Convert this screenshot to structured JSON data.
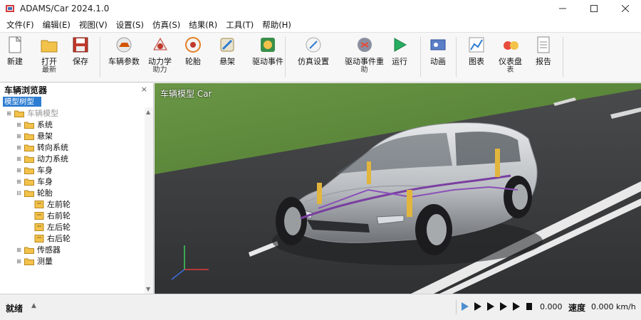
{
  "window": {
    "title": "ADAMS/Car 2024.1.0"
  },
  "menu": [
    "文件(F)",
    "编辑(E)",
    "视图(V)",
    "设置(S)",
    "仿真(S)",
    "结果(R)",
    "工具(T)",
    "帮助(H)"
  ],
  "toolbar": [
    {
      "label": "新建",
      "sub": "",
      "icon": "new-file-icon"
    },
    {
      "label": "打开",
      "sub": "最新",
      "icon": "open-folder-icon"
    },
    {
      "label": "保存",
      "sub": "",
      "icon": "save-icon"
    },
    {
      "label": "车辆参数",
      "sub": "",
      "icon": "vehicle-params-icon"
    },
    {
      "label": "动力学",
      "sub": "助力",
      "icon": "dynamics-icon"
    },
    {
      "label": "轮胎",
      "sub": "",
      "icon": "tire-icon"
    },
    {
      "label": "悬架",
      "sub": "",
      "icon": "suspension-icon"
    },
    {
      "label": "驱动事件",
      "sub": "",
      "icon": "drive-event-icon"
    },
    {
      "label": "仿真设置",
      "sub": "",
      "icon": "sim-settings-icon"
    },
    {
      "label": "驱动事件重",
      "sub": "助",
      "icon": "drive-event-repeat-icon"
    },
    {
      "label": "运行",
      "sub": "",
      "icon": "run-icon"
    },
    {
      "label": "动画",
      "sub": "",
      "icon": "animation-icon"
    },
    {
      "label": "图表",
      "sub": "",
      "icon": "plot-icon"
    },
    {
      "label": "仪表盘",
      "sub": "表",
      "icon": "dashboard-icon"
    },
    {
      "label": "报告",
      "sub": "",
      "icon": "report-icon"
    }
  ],
  "panel": {
    "title": "车辆浏览器",
    "close": "×",
    "search_value": "模型树型"
  },
  "tree": [
    {
      "label": "车辆模型",
      "level": 0,
      "exp": "⊞",
      "dim": true,
      "type": "folder"
    },
    {
      "label": "系统",
      "level": 1,
      "exp": "⊞",
      "dim": false,
      "type": "folder"
    },
    {
      "label": "悬架",
      "level": 1,
      "exp": "⊞",
      "dim": false,
      "type": "folder"
    },
    {
      "label": "转向系统",
      "level": 1,
      "exp": "⊞",
      "dim": false,
      "type": "folder"
    },
    {
      "label": "动力系统",
      "level": 1,
      "exp": "⊞",
      "dim": false,
      "type": "folder"
    },
    {
      "label": "车身",
      "level": 1,
      "exp": "⊞",
      "dim": false,
      "type": "folder"
    },
    {
      "label": "车身",
      "level": 1,
      "exp": "⊞",
      "dim": false,
      "type": "folder"
    },
    {
      "label": "轮胎",
      "level": 1,
      "exp": "⊟",
      "dim": false,
      "type": "folder"
    },
    {
      "label": "左前轮",
      "level": 2,
      "exp": "",
      "dim": false,
      "type": "doc"
    },
    {
      "label": "右前轮",
      "level": 2,
      "exp": "",
      "dim": false,
      "type": "doc"
    },
    {
      "label": "左后轮",
      "level": 2,
      "exp": "",
      "dim": false,
      "type": "doc"
    },
    {
      "label": "右后轮",
      "level": 2,
      "exp": "",
      "dim": false,
      "type": "doc"
    },
    {
      "label": "传感器",
      "level": 1,
      "exp": "⊞",
      "dim": false,
      "type": "folder"
    },
    {
      "label": "测量",
      "level": 1,
      "exp": "⊞",
      "dim": false,
      "type": "folder"
    }
  ],
  "viewport": {
    "title": "车辆模型 Car"
  },
  "status": {
    "left": "就绪",
    "caret": "▲",
    "time_value": "0.000",
    "speed_label": "速度",
    "speed_value": "0.000 km/h"
  },
  "colors": {
    "accent": "#2d7dd2",
    "folder": "#f2c24b",
    "road": "#3a3b3d",
    "grass": "#5f8a3a",
    "car_body": "#cfd2d6"
  }
}
